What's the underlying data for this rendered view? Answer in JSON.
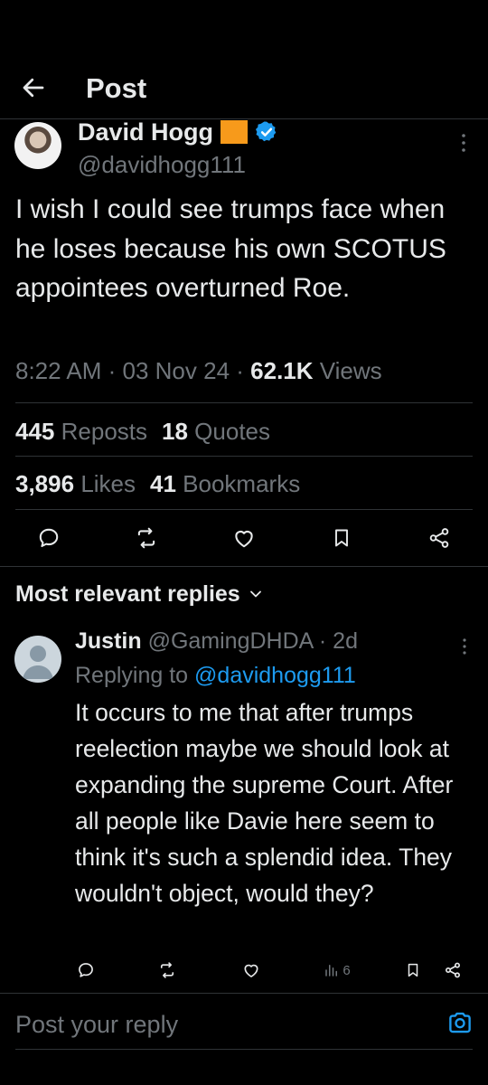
{
  "header": {
    "title": "Post",
    "back_icon": "arrow-left-icon"
  },
  "post": {
    "author_name": "David Hogg",
    "badge_color": "#f79a1b",
    "verified_color": "#1d9bf0",
    "handle": "@davidhogg111",
    "text": "I wish I could see trumps face when he loses because his own SCOTUS appointees overturned Roe.",
    "time": "8:22 AM",
    "date": "03 Nov 24",
    "views_count": "62.1K",
    "views_label": "Views",
    "reposts_count": "445",
    "reposts_label": "Reposts",
    "quotes_count": "18",
    "quotes_label": "Quotes",
    "likes_count": "3,896",
    "likes_label": "Likes",
    "bookmarks_count": "41",
    "bookmarks_label": "Bookmarks",
    "actions": [
      "reply-icon",
      "repost-icon",
      "like-icon",
      "bookmark-icon",
      "share-icon"
    ]
  },
  "replies_section": {
    "label": "Most relevant replies"
  },
  "reply": {
    "author_name": "Justin",
    "handle": "@GamingDHDA",
    "age": "2d",
    "replying_prefix": "Replying to",
    "replying_to": "@davidhogg111",
    "text": "It occurs to me that after trumps reelection maybe we should look at expanding the supreme Court. After all people like Davie here seem to think it's such a splendid idea. They wouldn't object, would they?",
    "views_count": "6"
  },
  "composer": {
    "placeholder": "Post your reply",
    "camera_icon": "camera-icon"
  }
}
